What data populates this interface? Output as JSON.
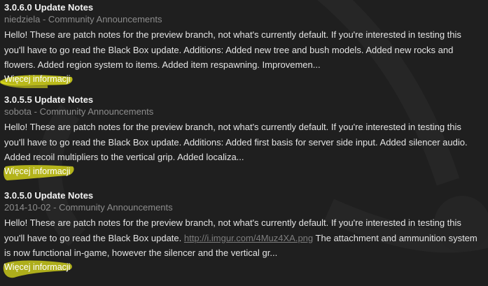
{
  "posts": [
    {
      "title": "3.0.6.0 Update Notes",
      "date": "niedziela",
      "separator": " - ",
      "category": "Community Announcements",
      "body_text": "Hello! These are patch notes for the preview branch, not what's currently default. If you're interested in testing this you'll have to go read the Black Box update. Additions: Added new tree and bush models. Added new rocks and flowers. Added region system to items. Added item respawning. Improvemen...",
      "more_label": "Więcej informacji"
    },
    {
      "title": "3.0.5.5 Update Notes",
      "date": "sobota",
      "separator": " - ",
      "category": "Community Announcements",
      "body_text": "Hello! These are patch notes for the preview branch, not what's currently default. If you're interested in testing this you'll have to go read the Black Box update. Additions: Added first basis for server side input. Added silencer audio. Added recoil multipliers to the vertical grip. Added localiza...",
      "more_label": "Więcej informacji"
    },
    {
      "title": "3.0.5.0 Update Notes",
      "date": "2014-10-02",
      "separator": " - ",
      "category": "Community Announcements",
      "body_before_link": "Hello! These are patch notes for the preview branch, not what's currently default. If you're interested in testing this you'll have to go read the Black Box update. ",
      "body_link": "http://i.imgur.com/4Muz4XA.png",
      "body_after_link": " The attachment and ammunition system is now functional in-game, however the silencer and the vertical gr...",
      "more_label": "Więcej informacji"
    }
  ],
  "colors": {
    "background": "#1f1f1f",
    "title": "#f2f2f2",
    "meta": "#8c8c8c",
    "body": "#e4e4e4",
    "link": "#7d7d7d",
    "highlight": "#e6e61a"
  }
}
